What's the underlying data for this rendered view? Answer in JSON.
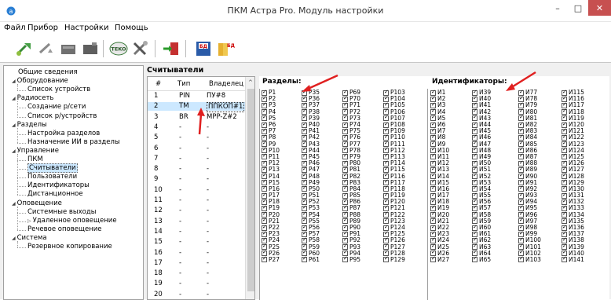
{
  "window": {
    "title": "ПКМ Астра Pro. Модуль настройки",
    "minimize": "–",
    "maximize": "□",
    "close": "✕"
  },
  "menu": [
    "Файл",
    "Прибор",
    "Настройки",
    "Помощь"
  ],
  "toolbar": {
    "icons": [
      "read-config-icon",
      "write-config-icon",
      "device1-icon",
      "device2-icon",
      "teko-icon",
      "tools-icon",
      "exit-icon",
      "save-db-icon",
      "open-db-icon"
    ],
    "save_db_label": "БД",
    "open_db_label": "БД"
  },
  "tree": [
    {
      "label": "Общие сведения",
      "level": 0,
      "expander": ""
    },
    {
      "label": "Оборудование",
      "level": 0,
      "expander": "◢"
    },
    {
      "label": "Список устройств",
      "level": 1,
      "expander": ""
    },
    {
      "label": "Радиосеть",
      "level": 0,
      "expander": "◢"
    },
    {
      "label": "Создание р/сети",
      "level": 1,
      "expander": ""
    },
    {
      "label": "Список р/устройств",
      "level": 1,
      "expander": ""
    },
    {
      "label": "Разделы",
      "level": 0,
      "expander": "◢"
    },
    {
      "label": "Настройка разделов",
      "level": 1,
      "expander": ""
    },
    {
      "label": "Назначение ИИ в разделы",
      "level": 1,
      "expander": ""
    },
    {
      "label": "Управление",
      "level": 0,
      "expander": "◢"
    },
    {
      "label": "ПКМ",
      "level": 1,
      "expander": ""
    },
    {
      "label": "Считыватели",
      "level": 1,
      "expander": "",
      "selected": true
    },
    {
      "label": "Пользователи",
      "level": 1,
      "expander": ""
    },
    {
      "label": "Идентификаторы",
      "level": 1,
      "expander": ""
    },
    {
      "label": "Дистанционное",
      "level": 1,
      "expander": ""
    },
    {
      "label": "Оповещение",
      "level": 0,
      "expander": "◢"
    },
    {
      "label": "Системные выходы",
      "level": 1,
      "expander": ""
    },
    {
      "label": "Удаленное оповещение",
      "level": 1,
      "expander": "▷"
    },
    {
      "label": "Речевое оповещение",
      "level": 1,
      "expander": ""
    },
    {
      "label": "Система",
      "level": 0,
      "expander": "◢"
    },
    {
      "label": "Резервное копирование",
      "level": 1,
      "expander": ""
    }
  ],
  "readers": {
    "title": "Считыватели",
    "headers": {
      "num": "#",
      "type": "Тип",
      "owner": "Владелец"
    },
    "scroll_up": "^",
    "rows": [
      {
        "num": "1",
        "type": "PIN",
        "owner": "ПУ#8"
      },
      {
        "num": "2",
        "type": "TM",
        "owner": "ППКОП#1",
        "selected": true
      },
      {
        "num": "3",
        "type": "BR",
        "owner": "MPP-Z#2"
      },
      {
        "num": "4",
        "type": "-",
        "owner": "-"
      },
      {
        "num": "5",
        "type": "-",
        "owner": "-"
      },
      {
        "num": "6",
        "type": "-",
        "owner": "-"
      },
      {
        "num": "7",
        "type": "-",
        "owner": "-"
      },
      {
        "num": "8",
        "type": "-",
        "owner": "-"
      },
      {
        "num": "9",
        "type": "-",
        "owner": "-"
      },
      {
        "num": "10",
        "type": "-",
        "owner": "-"
      },
      {
        "num": "11",
        "type": "-",
        "owner": "-"
      },
      {
        "num": "12",
        "type": "-",
        "owner": "-"
      },
      {
        "num": "13",
        "type": "-",
        "owner": "-"
      },
      {
        "num": "14",
        "type": "-",
        "owner": "-"
      },
      {
        "num": "15",
        "type": "-",
        "owner": "-"
      },
      {
        "num": "16",
        "type": "-",
        "owner": "-"
      },
      {
        "num": "17",
        "type": "-",
        "owner": "-"
      },
      {
        "num": "18",
        "type": "-",
        "owner": "-"
      },
      {
        "num": "19",
        "type": "-",
        "owner": "-"
      },
      {
        "num": "20",
        "type": "-",
        "owner": "-"
      }
    ]
  },
  "partitions": {
    "label": "Разделы:",
    "columns": [
      [
        "P1",
        "P2",
        "P3",
        "P4",
        "P5",
        "P6",
        "P7",
        "P8",
        "P9",
        "P10",
        "P11",
        "P12",
        "P13",
        "P14",
        "P15",
        "P16",
        "P17",
        "P18",
        "P19",
        "P20",
        "P21",
        "P22",
        "P23",
        "P24",
        "P25",
        "P26",
        "P27"
      ],
      [
        "P35",
        "P36",
        "P37",
        "P38",
        "P39",
        "P40",
        "P41",
        "P42",
        "P43",
        "P44",
        "P45",
        "P46",
        "P47",
        "P48",
        "P49",
        "P50",
        "P51",
        "P52",
        "P53",
        "P54",
        "P55",
        "P56",
        "P57",
        "P58",
        "P59",
        "P60",
        "P61"
      ],
      [
        "P69",
        "P70",
        "P71",
        "P72",
        "P73",
        "P74",
        "P75",
        "P76",
        "P77",
        "P78",
        "P79",
        "P80",
        "P81",
        "P82",
        "P83",
        "P84",
        "P85",
        "P86",
        "P87",
        "P88",
        "P89",
        "P90",
        "P91",
        "P92",
        "P93",
        "P94",
        "P95"
      ],
      [
        "P103",
        "P104",
        "P105",
        "P106",
        "P107",
        "P108",
        "P109",
        "P110",
        "P111",
        "P112",
        "P113",
        "P114",
        "P115",
        "P116",
        "P117",
        "P118",
        "P119",
        "P120",
        "P121",
        "P122",
        "P123",
        "P124",
        "P125",
        "P126",
        "P127",
        "P128",
        "P129"
      ]
    ]
  },
  "identifiers": {
    "label": "Идентификаторы:",
    "columns": [
      [
        "И1",
        "И2",
        "И3",
        "И4",
        "И5",
        "И6",
        "И7",
        "И8",
        "И9",
        "И10",
        "И11",
        "И12",
        "И13",
        "И14",
        "И15",
        "И16",
        "И17",
        "И18",
        "И19",
        "И20",
        "И21",
        "И22",
        "И23",
        "И24",
        "И25",
        "И26",
        "И27"
      ],
      [
        "И39",
        "И40",
        "И41",
        "И42",
        "И43",
        "И44",
        "И45",
        "И46",
        "И47",
        "И48",
        "И49",
        "И50",
        "И51",
        "И52",
        "И53",
        "И54",
        "И55",
        "И56",
        "И57",
        "И58",
        "И59",
        "И60",
        "И61",
        "И62",
        "И63",
        "И64",
        "И65"
      ],
      [
        "И77",
        "И78",
        "И79",
        "И80",
        "И81",
        "И82",
        "И83",
        "И84",
        "И85",
        "И86",
        "И87",
        "И88",
        "И89",
        "И90",
        "И91",
        "И92",
        "И93",
        "И94",
        "И95",
        "И96",
        "И97",
        "И98",
        "И99",
        "И100",
        "И101",
        "И102",
        "И103"
      ],
      [
        "И115",
        "И116",
        "И117",
        "И118",
        "И119",
        "И120",
        "И121",
        "И122",
        "И123",
        "И124",
        "И125",
        "И126",
        "И127",
        "И128",
        "И129",
        "И130",
        "И131",
        "И132",
        "И133",
        "И134",
        "И135",
        "И136",
        "И137",
        "И138",
        "И139",
        "И140",
        "И141"
      ]
    ]
  },
  "colors": {
    "close_button": "#c75050",
    "selection": "#cce8ff",
    "annotation_arrow": "#e02020"
  }
}
